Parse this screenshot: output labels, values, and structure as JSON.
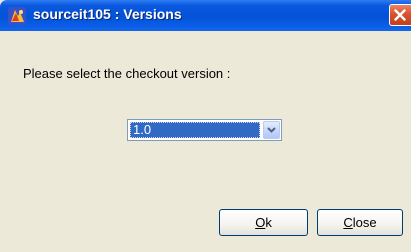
{
  "window": {
    "title": "sourceit105 : Versions"
  },
  "prompt": {
    "text": "Please select the checkout version :"
  },
  "version_select": {
    "selected_value": "1.0"
  },
  "buttons": {
    "ok_mnemonic": "O",
    "ok_rest": "k",
    "close_mnemonic": "C",
    "close_rest": "lose"
  },
  "icons": {
    "app": "app-icon",
    "close": "close-icon",
    "dropdown": "chevron-down-icon"
  },
  "colors": {
    "titlebar": "#0452D8",
    "dialog_background": "#ECE9D8",
    "selection": "#316AC5",
    "close_button": "#D9532C"
  }
}
